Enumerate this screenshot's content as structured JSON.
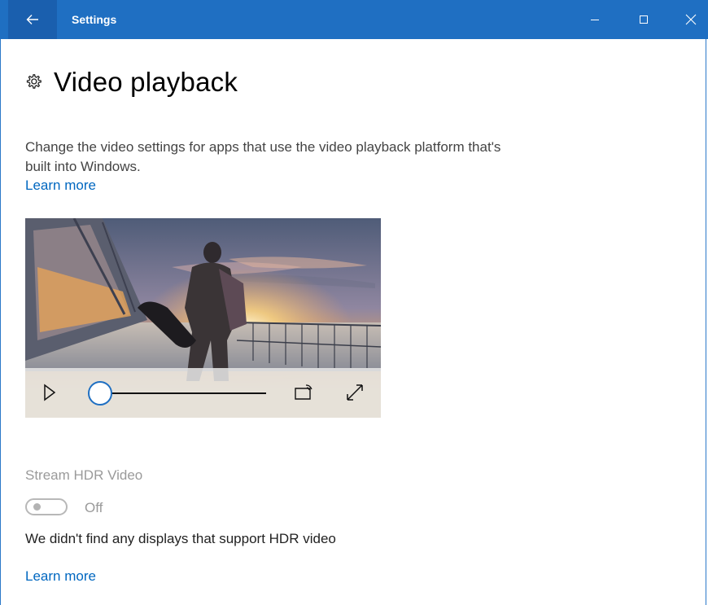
{
  "window": {
    "app_title": "Settings",
    "accent_color": "#1f6fc2",
    "back_icon": "back-arrow-icon",
    "controls": [
      "minimize-icon",
      "maximize-icon",
      "close-icon"
    ]
  },
  "page": {
    "title": "Video playback",
    "title_icon": "gear-icon",
    "description": "Change the video settings for apps that use the video playback platform that's built into Windows.",
    "learn_more": "Learn more"
  },
  "video_preview": {
    "scene": "person-walking-on-ship-deck-at-sunset",
    "progress": 0.0,
    "controls": [
      "play-icon",
      "seek-slider",
      "cast-icon",
      "fullscreen-icon"
    ]
  },
  "hdr": {
    "label": "Stream HDR Video",
    "toggle_state": "Off",
    "toggle_on": false,
    "note": "We didn't find any displays that support HDR video",
    "learn_more": "Learn more"
  }
}
